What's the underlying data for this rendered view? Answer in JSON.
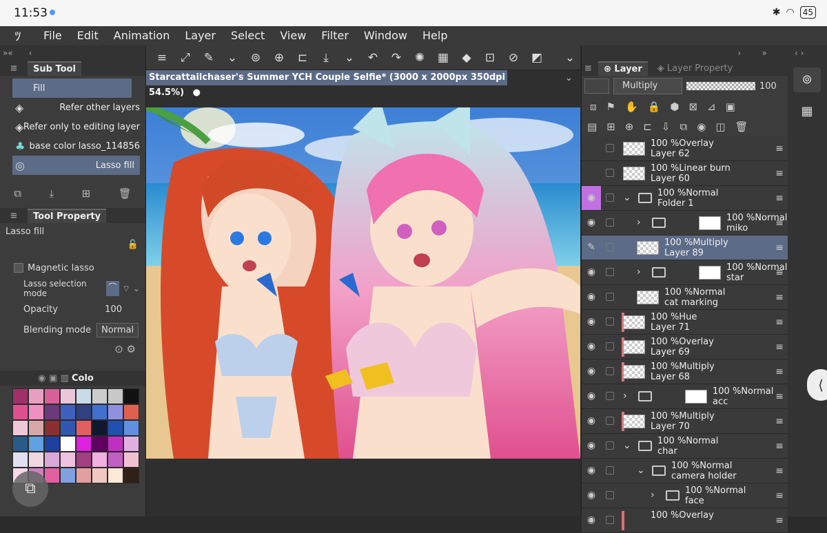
{
  "status": {
    "time": "11:53",
    "battery": "45"
  },
  "menu": [
    "File",
    "Edit",
    "Animation",
    "Layer",
    "Select",
    "View",
    "Filter",
    "Window",
    "Help"
  ],
  "subtool": {
    "title": "Sub Tool",
    "items": [
      "Fill",
      "Refer other layers",
      "Refer only to editing layer",
      "base color lasso_114856",
      "Lasso fill"
    ]
  },
  "toolprop": {
    "title": "Tool Property",
    "tool_name": "Lasso fill",
    "magnetic": "Magnetic lasso",
    "lasso_mode": "Lasso selection mode",
    "opacity_label": "Opacity",
    "opacity": "100",
    "blend_label": "Blending mode",
    "blend_value": "Normal"
  },
  "color_tab": "Colo",
  "document": {
    "title": "Starcattailchaser's Summer YCH Couple Selfie* (3000 x 2000px 350dpi 54.5%)"
  },
  "layer_panel": {
    "tab": "Layer",
    "tab2": "Layer Property",
    "blend": "Multiply",
    "opacity": "100",
    "layers": [
      {
        "mode": "100 %Overlay",
        "name": "Layer 62"
      },
      {
        "mode": "100 %Linear burn",
        "name": "Layer 60"
      },
      {
        "mode": "100 %Normal",
        "name": "Folder 1"
      },
      {
        "mode": "100 %Normal",
        "name": "miko"
      },
      {
        "mode": "100 %Multiply",
        "name": "Layer 89"
      },
      {
        "mode": "100 %Normal",
        "name": "star"
      },
      {
        "mode": "100 %Normal",
        "name": "cat marking"
      },
      {
        "mode": "100 %Hue",
        "name": "Layer 71"
      },
      {
        "mode": "100 %Overlay",
        "name": "Layer 69"
      },
      {
        "mode": "100 %Multiply",
        "name": "Layer 68"
      },
      {
        "mode": "100 %Normal",
        "name": "acc"
      },
      {
        "mode": "100 %Multiply",
        "name": "Layer 70"
      },
      {
        "mode": "100 %Normal",
        "name": "char"
      },
      {
        "mode": "100 %Normal",
        "name": "camera holder"
      },
      {
        "mode": "100 %Normal",
        "name": "face"
      },
      {
        "mode": "100 %Overlay",
        "name": ""
      }
    ]
  },
  "palette": [
    "#a0306a",
    "#e8a0c0",
    "#d86098",
    "#e8c8d8",
    "#c8dce8",
    "#ccc",
    "#c8c8c8",
    "#111",
    "#e05090",
    "#f090c0",
    "#6a3a7a",
    "#4060c0",
    "#304080",
    "#4070d0",
    "#9090e0",
    "#e06050",
    "#f0c8d8",
    "#d8a8a8",
    "#8a3030",
    "#3058b0",
    "#e06060",
    "#101830",
    "#2050b0",
    "#6090e0",
    "#2a5a8a",
    "#60a0e0",
    "#2040a0",
    "#fff",
    "#e020e0",
    "#600060",
    "#c030c0",
    "#e0b0e0",
    "#e0e0f0",
    "#f0d8e0",
    "#d8a8d8",
    "#f0c0e0",
    "#a04080",
    "#f0b0e0",
    "#c060c0",
    "#f0c0d0",
    "#f8d8e8",
    "#d080c0",
    "#e060a0",
    "#80a0e0",
    "#e0a0a0",
    "#f0c8c0",
    "#ffe8d8",
    "#302018"
  ]
}
